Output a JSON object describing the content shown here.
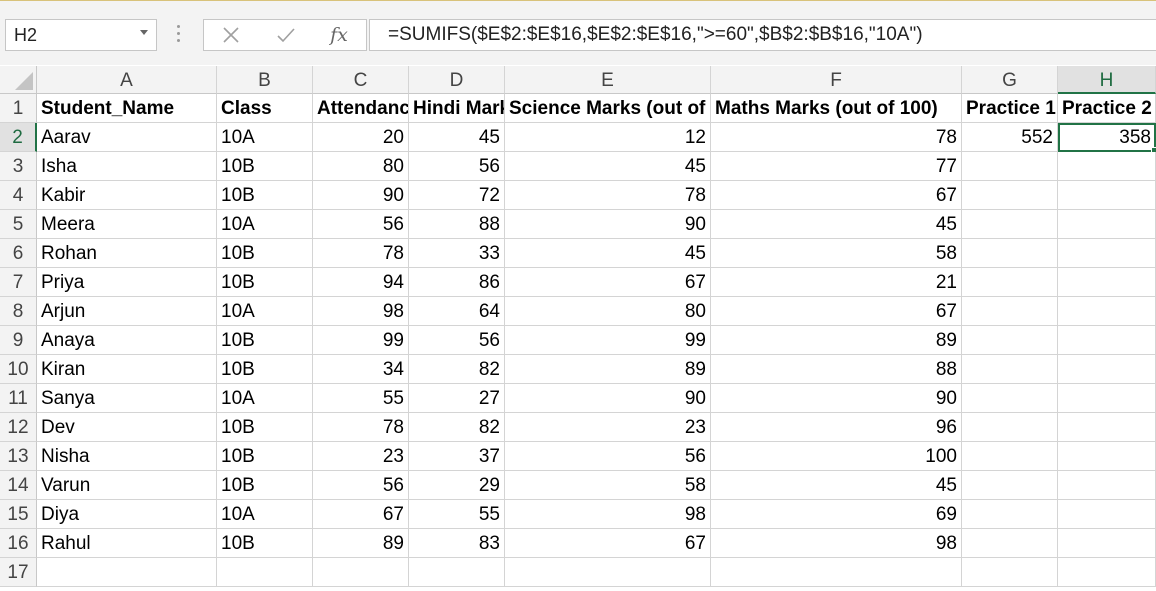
{
  "name_box": {
    "value": "H2"
  },
  "formula_bar": {
    "cancel_icon": "close-icon",
    "enter_icon": "check-icon",
    "function_label": "fx",
    "formula": "=SUMIFS($E$2:$E$16,$E$2:$E$16,\">=60\",$B$2:$B$16,\"10A\")"
  },
  "columns": [
    "A",
    "B",
    "C",
    "D",
    "E",
    "F",
    "G",
    "H"
  ],
  "selected_column": "H",
  "selected_row": 2,
  "rows": [
    {
      "num": 1,
      "cells": [
        "Student_Name",
        "Class",
        "Attendance",
        "Hindi Marks",
        "Science Marks (out of",
        "Maths Marks (out of 100)",
        "Practice 1",
        "Practice 2"
      ]
    },
    {
      "num": 2,
      "cells": [
        "Aarav",
        "10A",
        "20",
        "45",
        "12",
        "78",
        "552",
        "358"
      ]
    },
    {
      "num": 3,
      "cells": [
        "Isha",
        "10B",
        "80",
        "56",
        "45",
        "77",
        "",
        ""
      ]
    },
    {
      "num": 4,
      "cells": [
        "Kabir",
        "10B",
        "90",
        "72",
        "78",
        "67",
        "",
        ""
      ]
    },
    {
      "num": 5,
      "cells": [
        "Meera",
        "10A",
        "56",
        "88",
        "90",
        "45",
        "",
        ""
      ]
    },
    {
      "num": 6,
      "cells": [
        "Rohan",
        "10B",
        "78",
        "33",
        "45",
        "58",
        "",
        ""
      ]
    },
    {
      "num": 7,
      "cells": [
        "Priya",
        "10B",
        "94",
        "86",
        "67",
        "21",
        "",
        ""
      ]
    },
    {
      "num": 8,
      "cells": [
        "Arjun",
        "10A",
        "98",
        "64",
        "80",
        "67",
        "",
        ""
      ]
    },
    {
      "num": 9,
      "cells": [
        "Anaya",
        "10B",
        "99",
        "56",
        "99",
        "89",
        "",
        ""
      ]
    },
    {
      "num": 10,
      "cells": [
        "Kiran",
        "10B",
        "34",
        "82",
        "89",
        "88",
        "",
        ""
      ]
    },
    {
      "num": 11,
      "cells": [
        "Sanya",
        "10A",
        "55",
        "27",
        "90",
        "90",
        "",
        ""
      ]
    },
    {
      "num": 12,
      "cells": [
        "Dev",
        "10B",
        "78",
        "82",
        "23",
        "96",
        "",
        ""
      ]
    },
    {
      "num": 13,
      "cells": [
        "Nisha",
        "10B",
        "23",
        "37",
        "56",
        "100",
        "",
        ""
      ]
    },
    {
      "num": 14,
      "cells": [
        "Varun",
        "10B",
        "56",
        "29",
        "58",
        "45",
        "",
        ""
      ]
    },
    {
      "num": 15,
      "cells": [
        "Diya",
        "10A",
        "67",
        "55",
        "98",
        "69",
        "",
        ""
      ]
    },
    {
      "num": 16,
      "cells": [
        "Rahul",
        "10B",
        "89",
        "83",
        "67",
        "98",
        "",
        ""
      ]
    },
    {
      "num": 17,
      "cells": [
        "",
        "",
        "",
        "",
        "",
        "",
        "",
        ""
      ]
    }
  ]
}
